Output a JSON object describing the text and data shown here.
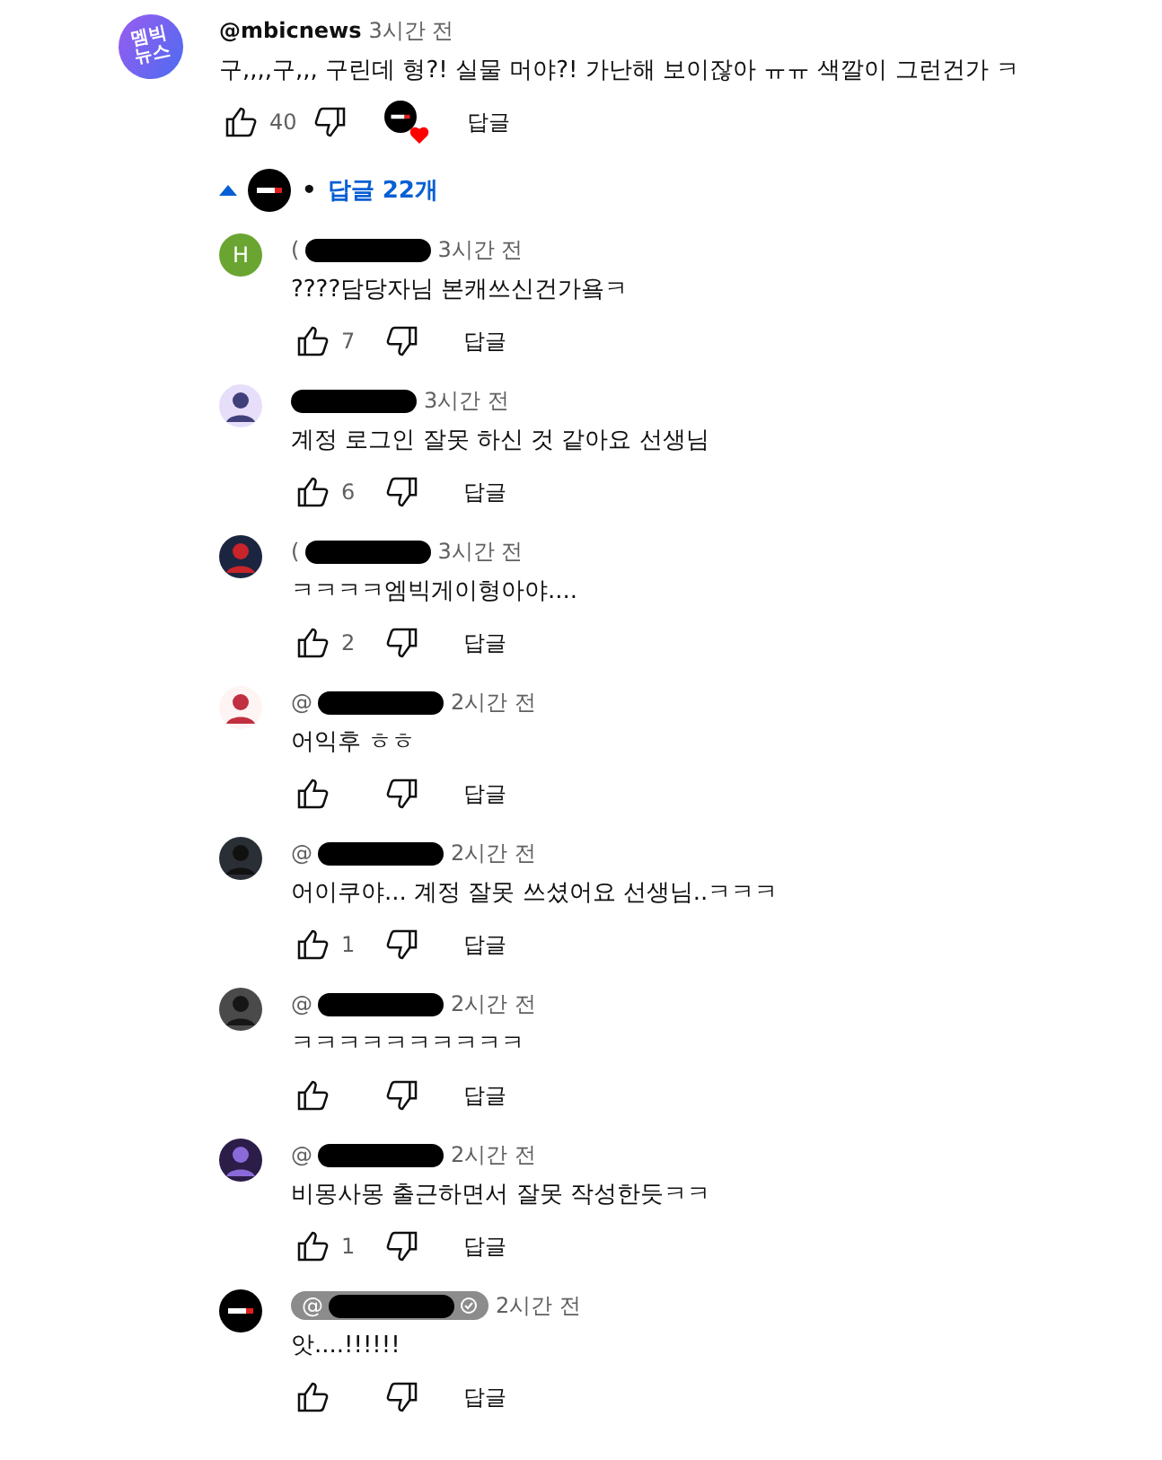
{
  "comment": {
    "avatar_text": "멤빅\n뉴스",
    "author": "@mbicnews",
    "time": "3시간 전",
    "text": "구,,,,구,,, 구린데 형?! 실물 머야?! 가난해 보이잖아 ㅠㅠ 색깔이 그런건가 ㅋ",
    "likes": "40",
    "hearted": true,
    "reply_label": "답글"
  },
  "replies_toggle": {
    "separator": "•",
    "label": "답글 22개",
    "expanded": true
  },
  "replies": [
    {
      "kind": "letter",
      "avatar_letter": "H",
      "handle": "(",
      "time": "3시간 전",
      "text": "????담당자님 본캐쓰신건가욬ㅋ",
      "likes": "7",
      "reply_label": "답글",
      "creator": false
    },
    {
      "kind": "picture",
      "time": "3시간 전",
      "text": "계정 로그인 잘못 하신 것 같아요 선생님",
      "likes": "6",
      "reply_label": "답글",
      "creator": false
    },
    {
      "kind": "picture",
      "handle": "(",
      "time": "3시간 전",
      "text": "ㅋㅋㅋㅋ엠빅게이형아야....",
      "likes": "2",
      "reply_label": "답글",
      "creator": false
    },
    {
      "kind": "picture",
      "handle": "@",
      "time": "2시간 전",
      "text": "어익후 ㅎㅎ",
      "reply_label": "답글",
      "creator": false
    },
    {
      "kind": "picture",
      "handle": "@",
      "time": "2시간 전",
      "text": "어이쿠야... 계정 잘못 쓰셨어요 선생님..ㅋㅋㅋ",
      "likes": "1",
      "reply_label": "답글",
      "creator": false
    },
    {
      "kind": "picture",
      "handle": "@",
      "time": "2시간 전",
      "text": "ㅋㅋㅋㅋㅋㅋㅋㅋㅋㅋ",
      "reply_label": "답글",
      "creator": false
    },
    {
      "kind": "picture",
      "handle": "@",
      "time": "2시간 전",
      "text": "비몽사몽 출근하면서 잘못 작성한듯ㅋㅋ",
      "likes": "1",
      "reply_label": "답글",
      "creator": false
    },
    {
      "kind": "logo",
      "handle": "@",
      "time": "2시간 전",
      "text": "앗....!!!!!!",
      "reply_label": "답글",
      "creator": true
    }
  ]
}
